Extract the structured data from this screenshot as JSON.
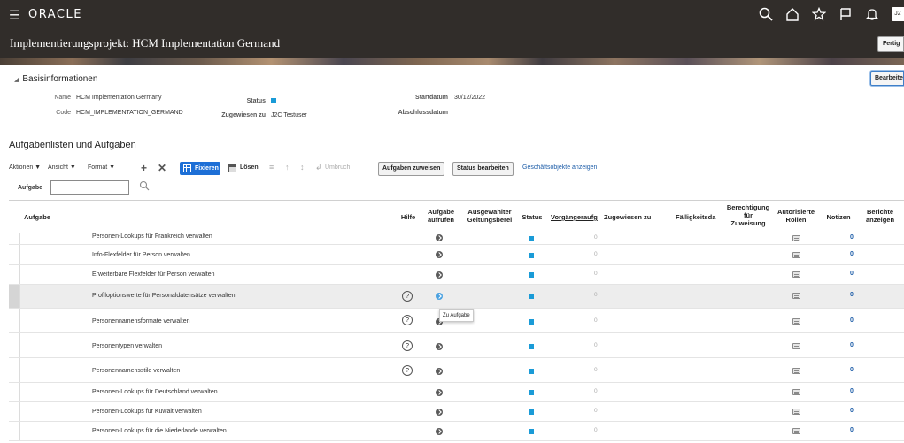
{
  "topbar": {
    "menu_icon": "hamburger-icon",
    "brand": "ORACLE",
    "avatar_initials": "J2",
    "icons": [
      "search-icon",
      "home-icon",
      "star-icon",
      "flag-icon",
      "bell-icon"
    ]
  },
  "header": {
    "title": "Implementierungsprojekt: HCM Implementation Germand",
    "done_label": "Fertig"
  },
  "basic_info": {
    "heading": "Basisinformationen",
    "edit_label": "Bearbeite",
    "name_label": "Name",
    "name_value": "HCM Implementation Germany",
    "code_label": "Code",
    "code_value": "HCM_IMPLEMENTATION_GERMAND",
    "status_label": "Status",
    "assigned_label": "Zugewiesen zu",
    "assigned_value": "J2C Testuser",
    "start_label": "Startdatum",
    "start_value": "30/12/2022",
    "end_label": "Abschlussdatum",
    "status_color": "#1a9bd7"
  },
  "tasks_section": {
    "heading": "Aufgabenlisten und Aufgaben"
  },
  "toolbar": {
    "actions": "Aktionen ▼",
    "view": "Ansicht ▼",
    "format": "Format ▼",
    "freeze": "Fixieren",
    "detach": "Lösen",
    "wrap": "Umbruch",
    "assign_tasks": "Aufgaben zuweisen",
    "edit_status": "Status bearbeiten",
    "business_objects": "Geschäftsobjekte anzeigen"
  },
  "filter": {
    "label": "Aufgabe",
    "value": ""
  },
  "table": {
    "headers": {
      "task": "Aufgabe",
      "help": "Hilfe",
      "go_task_1": "Aufgabe",
      "go_task_2": "aufrufen",
      "scope_1": "Ausgewählter",
      "scope_2": "Geltungsberei",
      "status": "Status",
      "predecessor": "Vorgängeraufg",
      "assigned": "Zugewiesen zu",
      "due": "Fälligkeitsda",
      "perm_1": "Berechtigung",
      "perm_2": "für",
      "perm_3": "Zuweisung",
      "roles_1": "Autorisierte",
      "roles_2": "Rollen",
      "notes": "Notizen",
      "reports_1": "Berichte",
      "reports_2": "anzeigen"
    },
    "rows": [
      {
        "name": "Personen-Lookups für Frankreich verwalten",
        "help": "",
        "predecessors": "0",
        "notes": "0"
      },
      {
        "name": "Info-Flexfelder für Person verwalten",
        "help": "",
        "predecessors": "0",
        "notes": "0"
      },
      {
        "name": "Erweiterbare Flexfelder für Person verwalten",
        "help": "",
        "predecessors": "0",
        "notes": "0"
      },
      {
        "name": "Profiloptionswerte für Personaldatensätze verwalten",
        "help": "?",
        "predecessors": "0",
        "notes": "0"
      },
      {
        "name": "Personennamensformate verwalten",
        "help": "?",
        "predecessors": "0",
        "notes": "0"
      },
      {
        "name": "Personentypen verwalten",
        "help": "?",
        "predecessors": "0",
        "notes": "0"
      },
      {
        "name": "Personennamensstile verwalten",
        "help": "?",
        "predecessors": "0",
        "notes": "0"
      },
      {
        "name": "Personen-Lookups für Deutschland verwalten",
        "help": "",
        "predecessors": "0",
        "notes": "0"
      },
      {
        "name": "Personen-Lookups für Kuwait verwalten",
        "help": "",
        "predecessors": "0",
        "notes": "0"
      },
      {
        "name": "Personen-Lookups für die Niederlande verwalten",
        "help": "",
        "predecessors": "0",
        "notes": "0"
      }
    ]
  },
  "tooltip": "Zu Aufgabe",
  "colors": {
    "topbar": "#312d2a",
    "accent_blue": "#1d6fd6",
    "status_blue": "#1a9bd7",
    "link": "#1d5da8"
  }
}
